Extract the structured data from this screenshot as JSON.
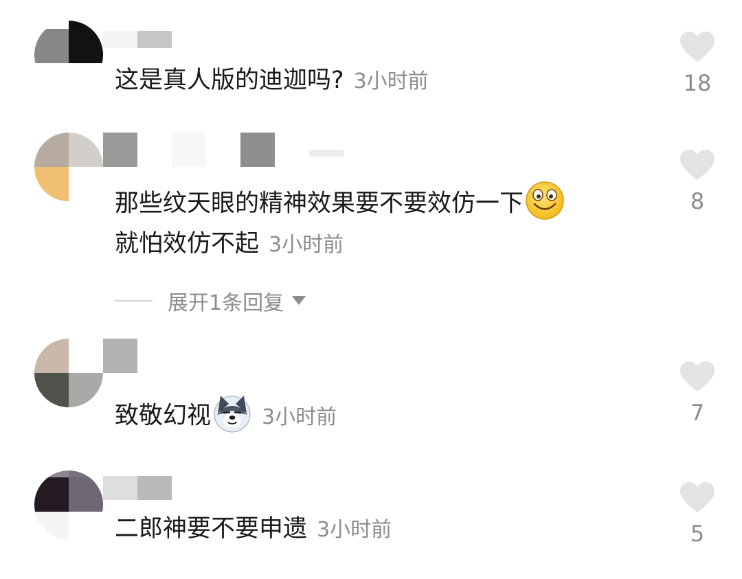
{
  "comments": [
    {
      "text": "这是真人版的迪迦吗?",
      "time": "3小时前",
      "likes": "18"
    },
    {
      "text_line1": "那些纹天眼的精神效果要不要效仿一下",
      "text_line2": "就怕效仿不起",
      "emoji": "grinning-face-emoji",
      "time": "3小时前",
      "likes": "8",
      "replies_label": "展开1条回复"
    },
    {
      "text": "致敬幻视",
      "emoji": "husky-dog-emoji",
      "time": "3小时前",
      "likes": "7"
    },
    {
      "text": "二郎神要不要申遗",
      "time": "3小时前",
      "likes": "5"
    }
  ],
  "icons": {
    "like": "heart-icon",
    "expand": "caret-down-icon"
  },
  "colors": {
    "text": "#1a1a1a",
    "meta": "#8c8c8c",
    "heart": "#e3e3e3"
  }
}
